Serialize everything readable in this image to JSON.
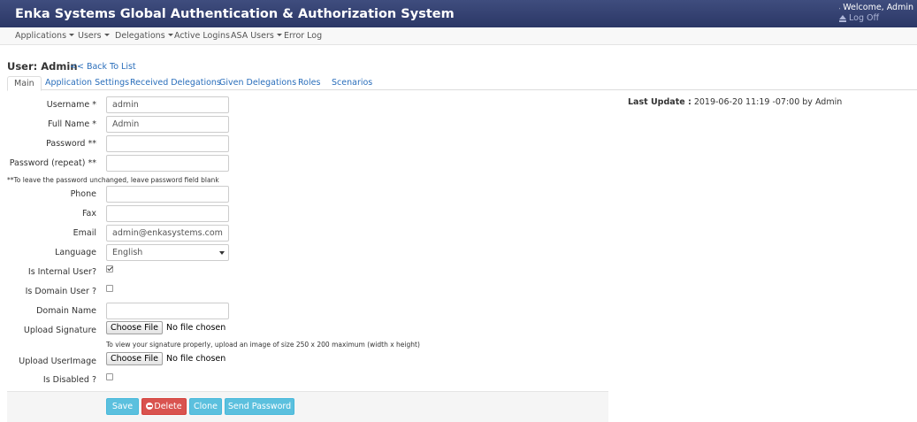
{
  "header": {
    "title": "Enka Systems Global Authentication & Authorization System",
    "welcome": "Welcome, Admin",
    "logoff": "Log Off"
  },
  "nav": {
    "items": [
      {
        "label": "Applications",
        "dropdown": true
      },
      {
        "label": "Users",
        "dropdown": true
      },
      {
        "label": "Delegations",
        "dropdown": true
      },
      {
        "label": "Active Logins",
        "dropdown": false
      },
      {
        "label": "ASA Users",
        "dropdown": true
      },
      {
        "label": "Error Log",
        "dropdown": false
      }
    ]
  },
  "page": {
    "title": "User: Admin",
    "back": "<< Back To List"
  },
  "tabs": [
    "Main",
    "Application Settings",
    "Received Delegations",
    "Given Delegations",
    "Roles",
    "Scenarios"
  ],
  "form": {
    "username_label": "Username *",
    "username_value": "admin",
    "fullname_label": "Full Name *",
    "fullname_value": "Admin",
    "password_label": "Password **",
    "password_repeat_label": "Password (repeat) **",
    "password_note": "**To leave the password unchanged, leave password field blank",
    "phone_label": "Phone",
    "fax_label": "Fax",
    "email_label": "Email",
    "email_value": "admin@enkasystems.com",
    "language_label": "Language",
    "language_value": "English",
    "internal_label": "Is Internal User?",
    "internal_checked": true,
    "domain_user_label": "Is Domain User ?",
    "domain_user_checked": false,
    "domain_name_label": "Domain Name",
    "signature_label": "Upload Signature",
    "signature_hint": "To view your signature properly, upload an image of size 250 x 200 maximum (width x height)",
    "userimage_label": "Upload UserImage",
    "choose_file": "Choose File",
    "no_file": "No file chosen",
    "disabled_label": "Is Disabled ?",
    "disabled_checked": false
  },
  "actions": {
    "save": "Save",
    "delete": "Delete",
    "clone": "Clone",
    "send_password": "Send Password"
  },
  "last_update": {
    "label": "Last Update :",
    "value": "2019-06-20 11:19 -07:00 by Admin"
  },
  "colors": {
    "header": "#2f3b6b",
    "link": "#2a6ebb",
    "info_button": "#5bc0de",
    "danger_button": "#d9534f"
  }
}
